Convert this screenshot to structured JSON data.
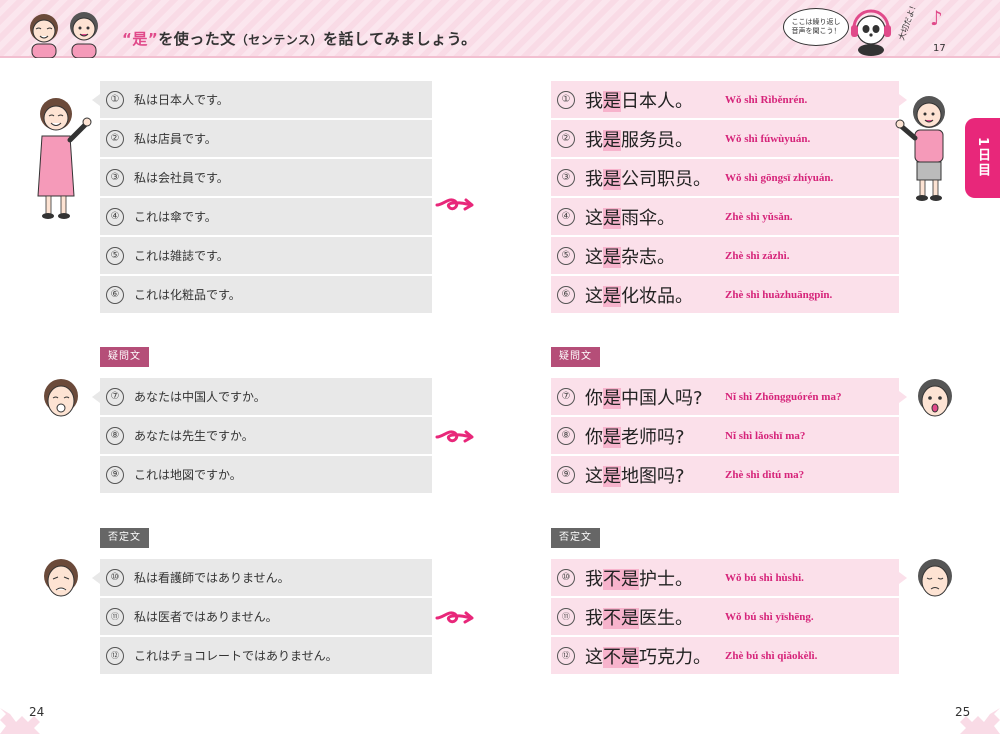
{
  "header": {
    "title_quote_open": "“",
    "title_word": "是",
    "title_quote_close": "”",
    "title_rest": "を使った文",
    "title_paren": "（センテンス）",
    "title_end": "を話してみましょう。",
    "speech_line1": "ここは繰り返し",
    "speech_line2": "音声を聞こう！",
    "side_comment": "大切だよ！",
    "page_top": "17"
  },
  "side_tab": "1日目",
  "section_labels": {
    "question": "疑問文",
    "negative": "否定文"
  },
  "affirmative": [
    {
      "num": "①",
      "ja": "私は日本人です。",
      "zh_pre": "我",
      "zh_mark": "是",
      "zh_post": "日本人。",
      "pinyin": "Wǒ shì Rìběnrén."
    },
    {
      "num": "②",
      "ja": "私は店員です。",
      "zh_pre": "我",
      "zh_mark": "是",
      "zh_post": "服务员。",
      "pinyin": "Wǒ shì fúwùyuán."
    },
    {
      "num": "③",
      "ja": "私は会社員です。",
      "zh_pre": "我",
      "zh_mark": "是",
      "zh_post": "公司职员。",
      "pinyin": "Wǒ shì gōngsī zhíyuán."
    },
    {
      "num": "④",
      "ja": "これは傘です。",
      "zh_pre": "这",
      "zh_mark": "是",
      "zh_post": "雨伞。",
      "pinyin": "Zhè shì yǔsǎn."
    },
    {
      "num": "⑤",
      "ja": "これは雑誌です。",
      "zh_pre": "这",
      "zh_mark": "是",
      "zh_post": "杂志。",
      "pinyin": "Zhè shì zázhì."
    },
    {
      "num": "⑥",
      "ja": "これは化粧品です。",
      "zh_pre": "这",
      "zh_mark": "是",
      "zh_post": "化妆品。",
      "pinyin": "Zhè shì huàzhuāngpǐn."
    }
  ],
  "question": [
    {
      "num": "⑦",
      "ja": "あなたは中国人ですか。",
      "zh_pre": "你",
      "zh_mark": "是",
      "zh_post": "中国人吗?",
      "pinyin": "Nǐ shì Zhōngguórén ma?"
    },
    {
      "num": "⑧",
      "ja": "あなたは先生ですか。",
      "zh_pre": "你",
      "zh_mark": "是",
      "zh_post": "老师吗?",
      "pinyin": "Nǐ shì lǎoshī ma?"
    },
    {
      "num": "⑨",
      "ja": "これは地図ですか。",
      "zh_pre": "这",
      "zh_mark": "是",
      "zh_post": "地图吗?",
      "pinyin": "Zhè shì dìtú ma?"
    }
  ],
  "negative": [
    {
      "num": "⑩",
      "ja": "私は看護師ではありません。",
      "zh_pre": "我",
      "zh_mark": "不是",
      "zh_post": "护士。",
      "pinyin": "Wǒ bú shì hùshi."
    },
    {
      "num": "⑪",
      "ja": "私は医者ではありません。",
      "zh_pre": "我",
      "zh_mark": "不是",
      "zh_post": "医生。",
      "pinyin": "Wǒ bú shì yīshēng."
    },
    {
      "num": "⑫",
      "ja": "これはチョコレートではありません。",
      "zh_pre": "这",
      "zh_mark": "不是",
      "zh_post": "巧克力。",
      "pinyin": "Zhè bú shì qiǎokèlì."
    }
  ],
  "footer": {
    "left_page": "24",
    "right_page": "25"
  },
  "colors": {
    "accent": "#e8277a",
    "pinyin": "#d6247a",
    "highlight": "#f7b3cc",
    "chinese_row": "#fbe0ea",
    "japanese_row": "#e8e8e8",
    "label_question": "#b54e78",
    "label_negative": "#666666"
  }
}
